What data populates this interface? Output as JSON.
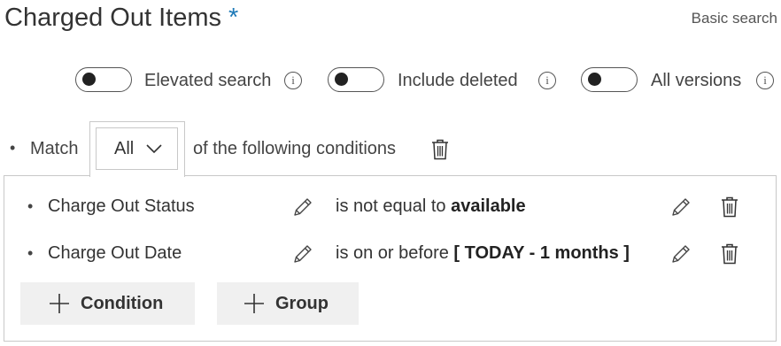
{
  "page": {
    "title": "Charged Out Items",
    "required_marker": "*",
    "basic_search_label": "Basic search"
  },
  "toggles": [
    {
      "label": "Elevated search",
      "on": false,
      "info_glyph": "i"
    },
    {
      "label": "Include deleted",
      "on": false,
      "info_glyph": "i"
    },
    {
      "label": "All versions",
      "on": false,
      "info_glyph": "i"
    }
  ],
  "match": {
    "bullet": "•",
    "prefix": "Match",
    "selected": "All",
    "suffix": "of the following conditions"
  },
  "conditions": [
    {
      "bullet": "•",
      "field": "Charge Out Status",
      "operator": "is not equal to",
      "value": "available"
    },
    {
      "bullet": "•",
      "field": "Charge Out Date",
      "operator": "is on or before",
      "value": "[ TODAY - 1 months ]"
    }
  ],
  "buttons": {
    "add_condition": "Condition",
    "add_group": "Group"
  },
  "icons": {
    "toggle": "toggle-switch",
    "info": "info-icon",
    "chevron": "chevron-down-icon",
    "delete": "trash-icon",
    "edit": "pencil-icon",
    "add": "plus-icon"
  },
  "colors": {
    "accent": "#1e7ab8",
    "text": "#333333",
    "border": "#c8c8c8",
    "button_bg": "#f0f0f0"
  }
}
